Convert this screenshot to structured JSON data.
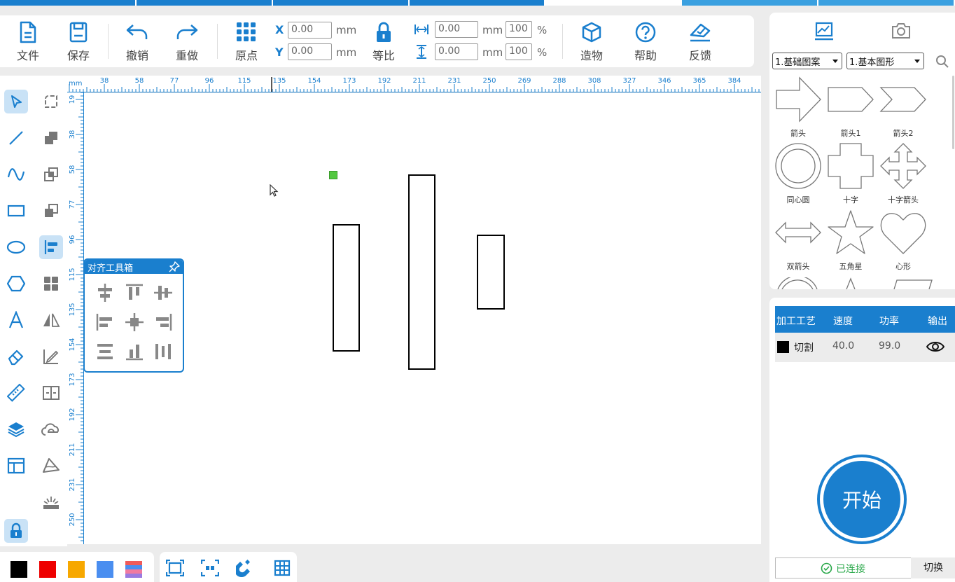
{
  "colors": {
    "accent": "#1a7fce",
    "active_bg": "#c9e2f6",
    "layer_cut": "#000000"
  },
  "top_strip_colors": [
    "#1a7fce",
    "#1a7fce",
    "#1a7fce",
    "#1a7fce",
    "#ffffff",
    "#3aa0e0",
    "#3aa0e0"
  ],
  "toolbar": {
    "file": "文件",
    "save": "保存",
    "undo": "撤销",
    "redo": "重做",
    "origin": "原点",
    "x_label": "X",
    "y_label": "Y",
    "x_value": "0.00",
    "y_value": "0.00",
    "unit_mm": "mm",
    "proportional": "等比",
    "width_value": "0.00",
    "height_value": "0.00",
    "width_pct": "100",
    "height_pct": "100",
    "pct": "%",
    "build": "造物",
    "help": "帮助",
    "feedback": "反馈"
  },
  "ruler": {
    "unit": "mm",
    "top_labels": [
      "38",
      "58",
      "77",
      "96",
      "115",
      "135",
      "154",
      "173",
      "192",
      "211",
      "231",
      "250",
      "269",
      "288",
      "308",
      "327",
      "346",
      "365",
      "384"
    ],
    "left_labels": [
      "19",
      "38",
      "58",
      "77",
      "96",
      "115",
      "135",
      "154",
      "173",
      "192",
      "211",
      "231",
      "250"
    ]
  },
  "left_tools": [
    "select-tool",
    "node-edit-tool",
    "line-tool",
    "combine-tool",
    "curve-tool",
    "copy-tool",
    "rectangle-tool",
    "array-tool",
    "ellipse-tool",
    "align-tool",
    "polygon-tool",
    "grid-tool",
    "text-tool",
    "mirror-tool",
    "eraser-tool",
    "draw-edit-tool",
    "measure-tool",
    "split-tool",
    "layers-tool",
    "trace-tool",
    "layout-tool",
    "path-tool",
    "laser-tool",
    "lock-tool"
  ],
  "align_box": {
    "title": "对齐工具箱"
  },
  "color_swatches": [
    "#000000",
    "#ee0000",
    "#f7a800",
    "#4a8ef0",
    "gradient"
  ],
  "right_panel": {
    "category_select": "1.基础图案",
    "subcategory_select": "1.基本图形",
    "shapes": [
      "箭头",
      "箭头1",
      "箭头2",
      "同心圆",
      "十字",
      "十字箭头",
      "双箭头",
      "五角星",
      "心形"
    ]
  },
  "process": {
    "headers": [
      "加工工艺",
      "速度",
      "功率",
      "输出"
    ],
    "row": {
      "name": "切割",
      "speed": "40.0",
      "power": "99.0",
      "color": "#000000"
    },
    "start": "开始",
    "status": "已连接",
    "switch": "切换"
  }
}
